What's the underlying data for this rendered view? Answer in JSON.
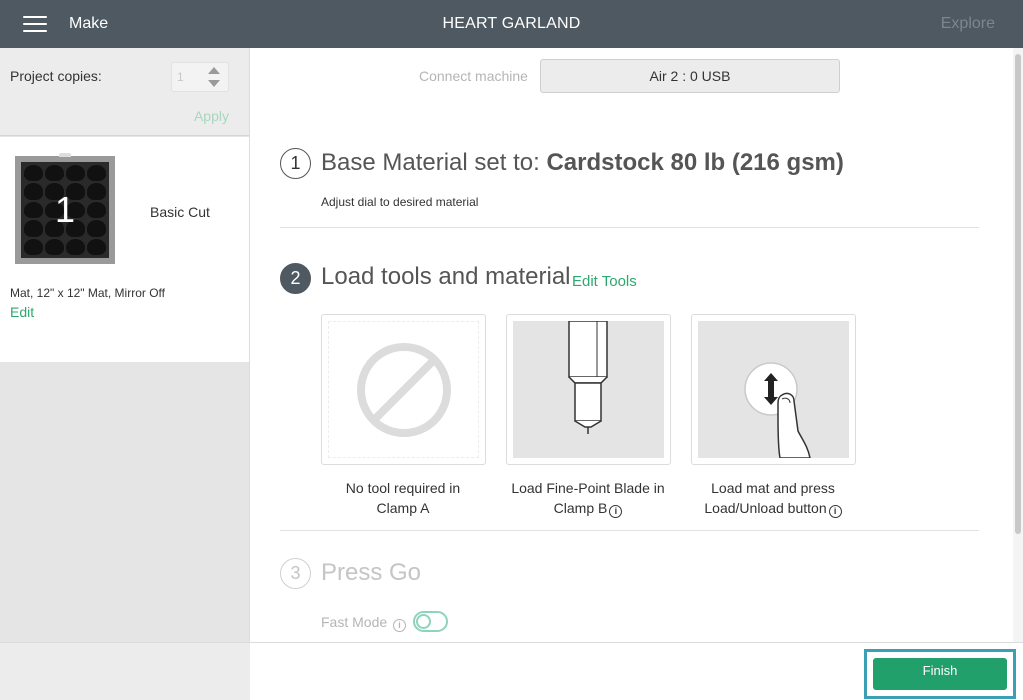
{
  "topbar": {
    "menu_icon": "hamburger-menu-icon",
    "app_title": "Make",
    "project_title": "HEART GARLAND",
    "explore_label": "Explore"
  },
  "sidebar": {
    "copies_label": "Project copies:",
    "copies_value": "1",
    "apply_label": "Apply",
    "mat": {
      "number": "1",
      "cut_label": "Basic Cut",
      "description": "Mat, 12\" x 12\" Mat, Mirror Off",
      "edit_label": "Edit"
    }
  },
  "connect": {
    "label": "Connect machine",
    "machine": "Air 2 : 0 USB"
  },
  "steps": [
    {
      "number": "1",
      "title_prefix": "Base Material set to: ",
      "title_value": "Cardstock 80 lb (216 gsm)",
      "subtitle": "Adjust dial to desired material"
    },
    {
      "number": "2",
      "title": "Load tools and material",
      "action_label": "Edit Tools",
      "cards": [
        {
          "icon": "no-tool-icon",
          "caption_line1": "No tool required in",
          "caption_line2": "Clamp A",
          "has_info": false
        },
        {
          "icon": "fine-point-blade-icon",
          "caption_line1": "Load Fine-Point Blade in",
          "caption_line2": "Clamp B",
          "has_info": true
        },
        {
          "icon": "load-unload-button-icon",
          "caption_line1": "Load mat and press",
          "caption_line2": "Load/Unload button",
          "has_info": true
        }
      ]
    },
    {
      "number": "3",
      "title": "Press Go",
      "fast_mode_label": "Fast Mode",
      "fast_mode_on": false
    }
  ],
  "footer": {
    "finish_label": "Finish"
  },
  "colors": {
    "topbar": "#4f5962",
    "accent_green": "#22a06b",
    "link_green": "#2ea86e",
    "highlight_border": "#3b9fb6"
  }
}
